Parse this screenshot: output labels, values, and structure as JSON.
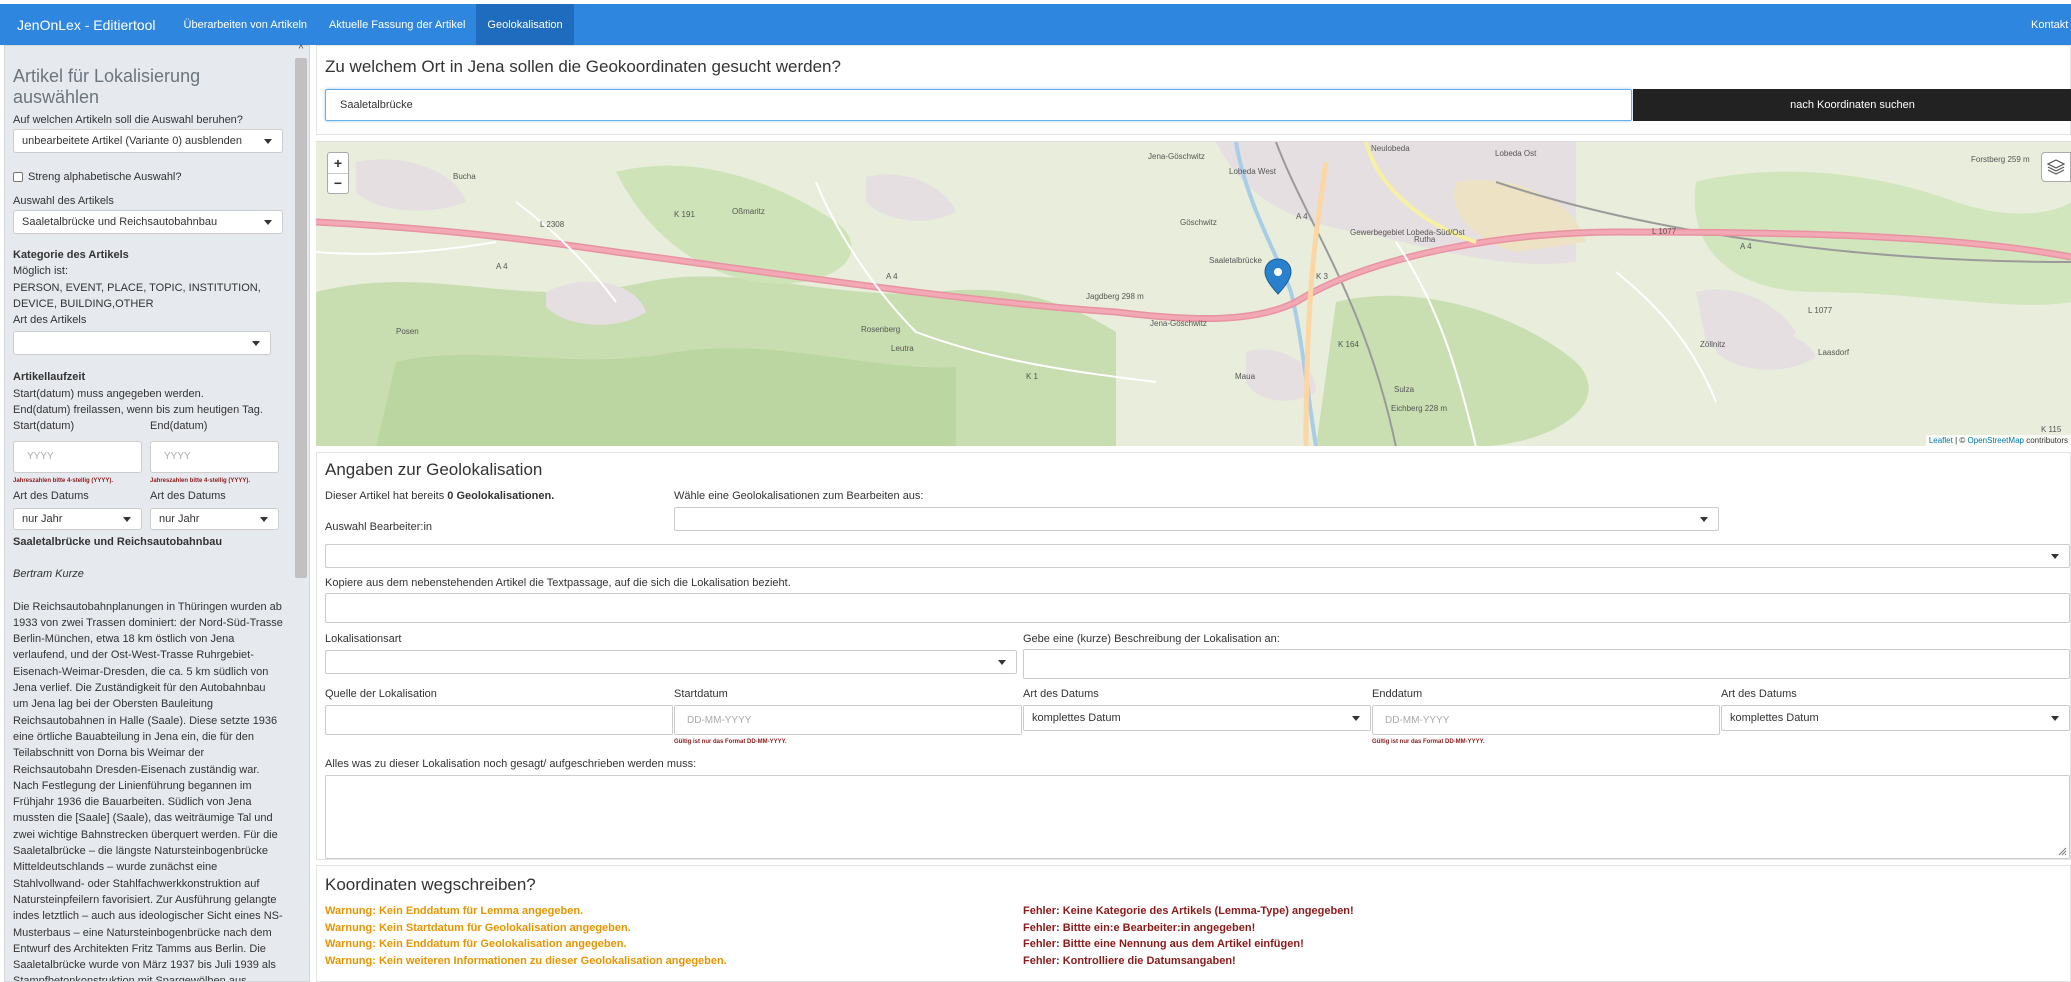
{
  "navbar": {
    "brand": "JenOnLex - Editiertool",
    "items": [
      {
        "label": "Überarbeiten von Artikeln"
      },
      {
        "label": "Aktuelle Fassung der Artikel"
      },
      {
        "label": "Geolokalisation"
      }
    ],
    "active_index": 2,
    "right_label": "Kontakt"
  },
  "sidebar": {
    "title": "Artikel für Lokalisierung auswählen",
    "selection_basis_label": "Auf welchen Artikeln soll die Auswahl beruhen?",
    "selection_basis_value": "unbearbeitete Artikel (Variante 0) ausblenden",
    "strict_alpha_label": "Streng alphabetische Auswahl?",
    "article_select_label": "Auswahl des Artikels",
    "article_select_value": "Saaletalbrücke und Reichsautobahnbau",
    "category_heading": "Kategorie des Artikels",
    "category_possible": "Möglich ist:",
    "category_values": "PERSON, EVENT, PLACE, TOPIC, INSTITUTION, DEVICE, BUILDING,OTHER",
    "category_type_label": "Art des Artikels",
    "category_type_value": "",
    "runtime_heading": "Artikellaufzeit",
    "runtime_note1": "Start(datum) muss angegeben werden.",
    "runtime_note2": "End(datum) freilassen, wenn bis zum heutigen Tag.",
    "start_label": "Start(datum)",
    "end_label": "End(datum)",
    "start_placeholder": "YYYY",
    "end_placeholder": "YYYY",
    "year_hint": "Jahreszahlen bitte 4-stellig (YYYY).",
    "date_type_label": "Art des Datums",
    "date_type_value": "nur Jahr",
    "article_title": "Saaletalbrücke und Reichsautobahnbau",
    "author": "Bertram Kurze",
    "body": "Die Reichsautobahnplanungen in Thüringen wurden ab 1933 von zwei Trassen dominiert: der Nord-Süd-Trasse Berlin-München, etwa 18 km östlich von Jena verlaufend, und der Ost-West-Trasse Ruhrgebiet-Eisenach-Weimar-Dresden, die ca. 5 km südlich von Jena verlief. Die Zuständigkeit für den Autobahnbau um Jena lag bei der Obersten Bauleitung Reichsautobahnen in Halle (Saale). Diese setzte 1936 eine örtliche Bauabteilung in Jena ein, die für den Teilabschnitt von Dorna bis Weimar der Reichsautobahn Dresden-Eisenach zuständig war. Nach Festlegung der Linienführung begannen im Frühjahr 1936 die Bauarbeiten. Südlich von Jena mussten die [Saale] (Saale), das weiträumige Tal und zwei wichtige Bahnstrecken überquert werden. Für die Saaletalbrücke – die längste Natursteinbogenbrücke Mitteldeutschlands – wurde zunächst eine Stahlvollwand- oder Stahlfachwerkkonstruktion auf Natursteinpfeilern favorisiert. Zur Ausführung gelangte indes letztlich – auch aus ideologischer Sicht eines NS-Musterbaus – eine Natursteinbogenbrücke nach dem Entwurf des Architekten Fritz Tamms aus Berlin. Die Saaletalbrücke wurde von März 1937 bis Juli 1939 als Stampfbetonkonstruktion mit Spargewölben aus"
  },
  "search": {
    "question": "Zu welchem Ort in Jena sollen die Geokoordinaten gesucht werden?",
    "value": "Saaletalbrücke",
    "button_label": "nach Koordinaten suchen"
  },
  "map": {
    "zoom_in": "+",
    "zoom_out": "−",
    "attribution_leaflet": "Leaflet",
    "attribution_sep": " | © ",
    "attribution_osm": "OpenStreetMap",
    "attribution_tail": " contributors",
    "labels": [
      "Bucha",
      "Oßmaritz",
      "Göschwitz",
      "Saaletalbrücke",
      "Lobeda West",
      "Neulobeda",
      "Lobeda Ost",
      "Rutha",
      "Zöllnitz",
      "Laasdorf",
      "Leutra",
      "Sulza",
      "Maua",
      "Posen",
      "Jena-Göschwitz",
      "Jena-Göschwitz",
      "Forstberg 259 m",
      "Eichberg 228 m",
      "Jagdberg 298 m",
      "Rosenberg",
      "Gewerbegebiet Lobeda-Süd/Ost",
      "A 4",
      "A 4",
      "A 4",
      "A 4",
      "K 191",
      "L 2308",
      "K 1",
      "K 3",
      "K 164",
      "L 1077",
      "L 1077",
      "K 115"
    ],
    "marker_color": "#2a81cb"
  },
  "geo": {
    "heading": "Angaben zur Geolokalisation",
    "count_prefix": "Dieser Artikel hat bereits ",
    "count_value": "0 Geolokalisationen.",
    "choose_label": "Wähle eine Geolokalisationen zum Bearbeiten aus:",
    "editor_label": "Auswahl Bearbeiter:in",
    "copy_label": "Kopiere aus dem nebenstehenden Artikel die Textpassage, auf die sich die Lokalisation bezieht.",
    "type_label": "Lokalisationsart",
    "desc_label": "Gebe eine (kurze) Beschreibung der Lokalisation an:",
    "source_label": "Quelle der Lokalisation",
    "start_label": "Startdatum",
    "start_placeholder": "DD-MM-YYYY",
    "date_type_label": "Art des Datums",
    "date_type_value": "komplettes Datum",
    "end_label": "Enddatum",
    "end_placeholder": "DD-MM-YYYY",
    "date_hint": "Gültig ist nur das Format DD-MM-YYYY.",
    "notes_label": "Alles was zu dieser Lokalisation noch gesagt/ aufgeschrieben werden muss:"
  },
  "save": {
    "heading": "Koordinaten wegschreiben?",
    "warnings": [
      "Warnung: Kein Enddatum für Lemma angegeben.",
      "Warnung: Kein Startdatum für Geolokalisation angegeben.",
      "Warnung: Kein Enddatum für Geolokalisation angegeben.",
      "Warnung: Kein weiteren Informationen zu dieser Geolokalisation angegeben."
    ],
    "errors": [
      "Fehler: Keine Kategorie des Artikels (Lemma-Type) angegeben!",
      "Fehler: Bittte ein:e Bearbeiter:in angegeben!",
      "Fehler: Bittte eine Nennung aus dem Artikel einfügen!",
      "Fehler: Kontrolliere die Datumsangaben!"
    ],
    "warning_color": "#e69500",
    "error_color": "#8b1a1a"
  },
  "colors": {
    "navbar": "#2e86de",
    "navbar_active": "#1f6bbd",
    "sidebar_bg": "#e6e9ee",
    "button_dark": "#222222"
  }
}
